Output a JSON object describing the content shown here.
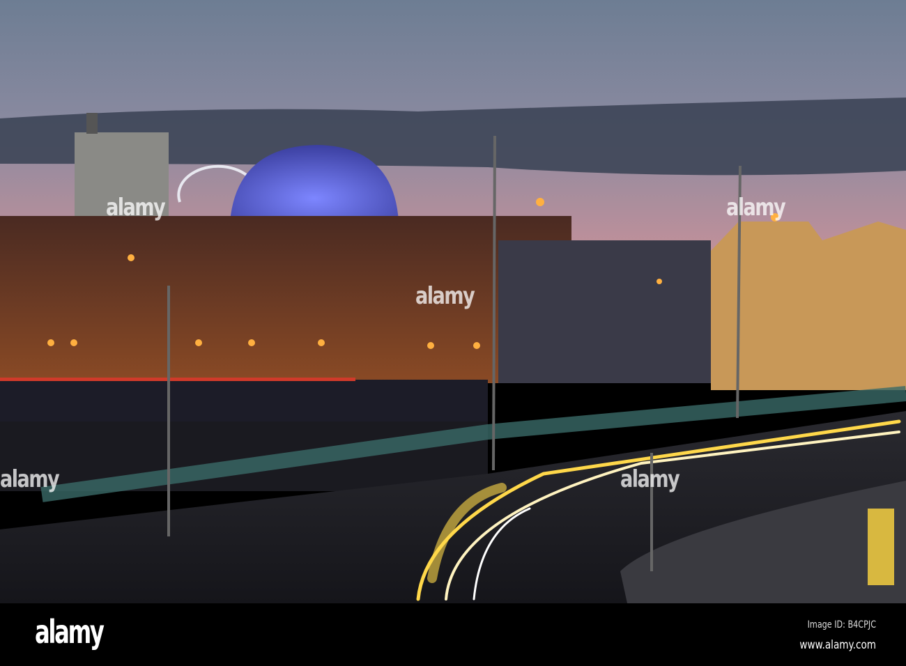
{
  "watermark": {
    "logo": "alamy",
    "repeat": "alamy"
  },
  "footer": {
    "logo": "alamy",
    "image_id": "Image ID: B4CPJC",
    "url": "www.alamy.com"
  },
  "colors": {
    "sky_top": "#6d7d93",
    "sky_bottom": "#b98d92",
    "dome": "#5a64d8",
    "trail": "#ffd84a",
    "brick": "#7a3e24"
  }
}
